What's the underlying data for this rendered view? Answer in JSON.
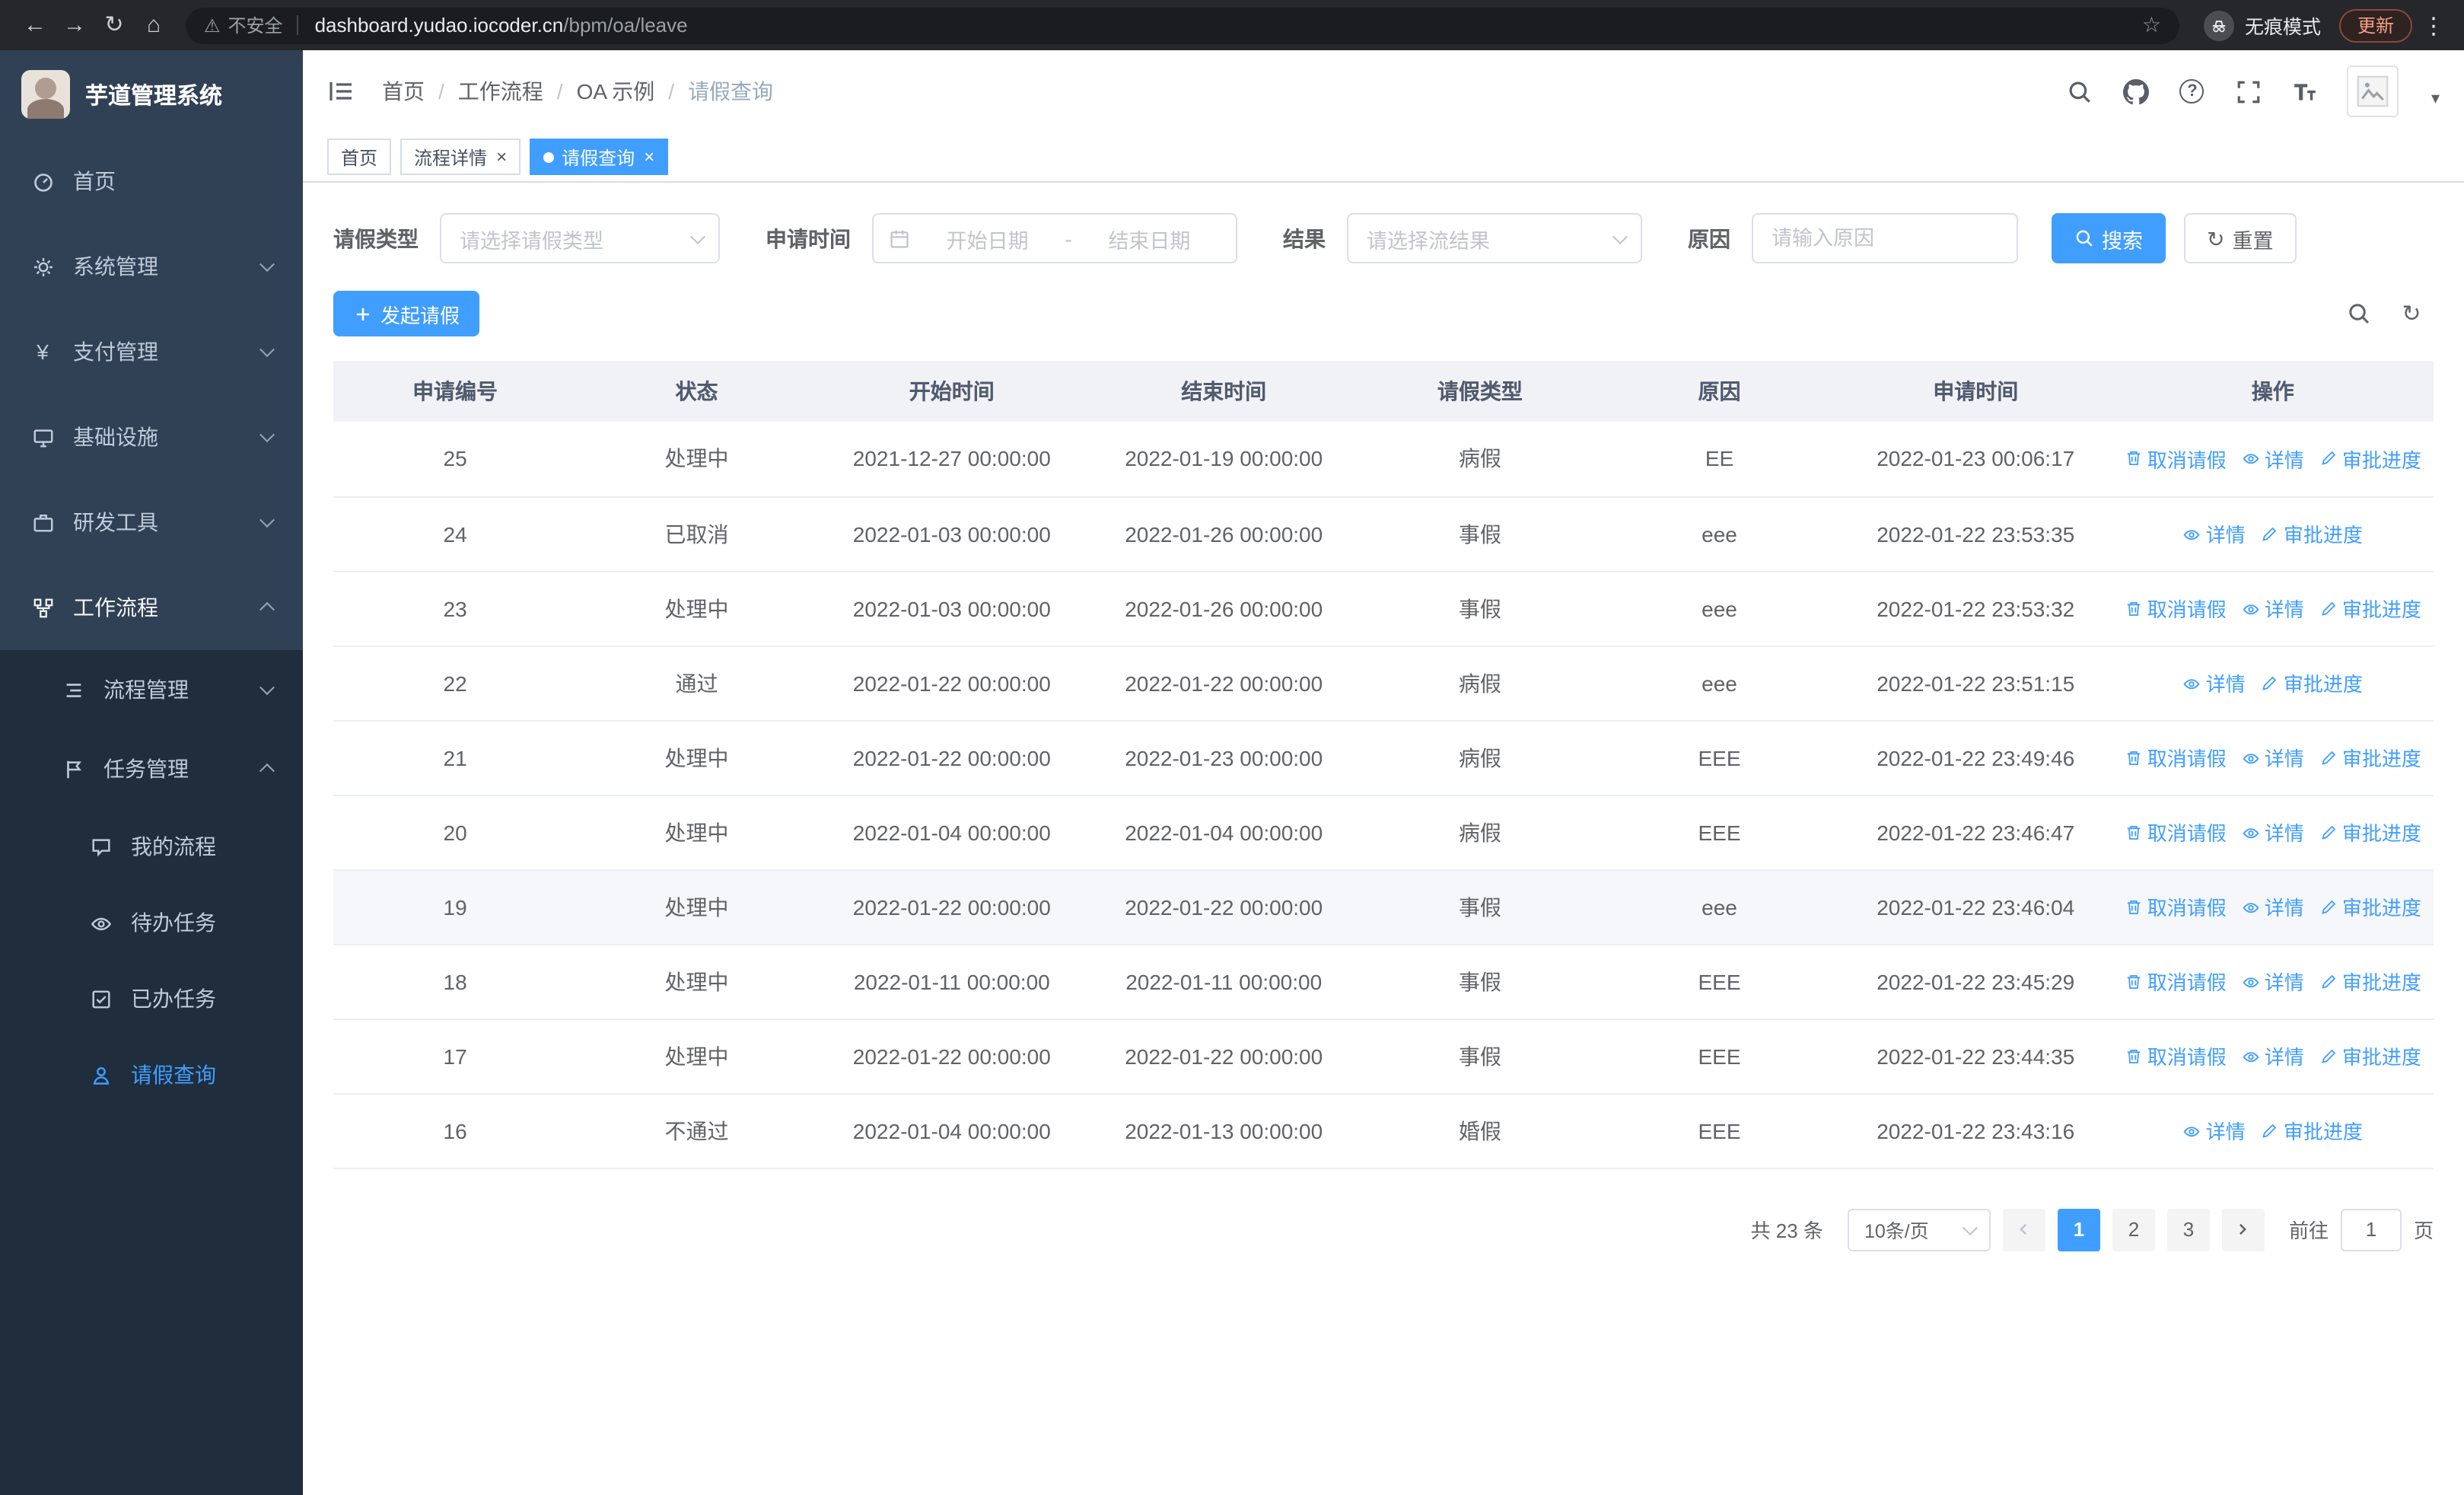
{
  "icons": {
    "back": "←",
    "forward": "→",
    "reload": "↻",
    "home": "⌂",
    "warning": "⚠",
    "star": "☆",
    "menu_dots": "⋮",
    "caret": "▾",
    "close": "×",
    "refresh": "↻",
    "question": "?",
    "yen": "¥"
  },
  "browser": {
    "security_label": "不安全",
    "url_domain": "dashboard.yudao.iocoder.cn",
    "url_path": "/bpm/oa/leave",
    "incognito_label": "无痕模式",
    "update_label": "更新"
  },
  "sidebar": {
    "logo_title": "芋道管理系统",
    "items": [
      {
        "label": "首页"
      },
      {
        "label": "系统管理"
      },
      {
        "label": "支付管理"
      },
      {
        "label": "基础设施"
      },
      {
        "label": "研发工具"
      },
      {
        "label": "工作流程"
      }
    ],
    "submenu": [
      {
        "label": "流程管理"
      },
      {
        "label": "任务管理"
      }
    ],
    "tasks_children": [
      {
        "label": "我的流程"
      },
      {
        "label": "待办任务"
      },
      {
        "label": "已办任务"
      },
      {
        "label": "请假查询"
      }
    ]
  },
  "header": {
    "breadcrumb": [
      "首页",
      "工作流程",
      "OA 示例",
      "请假查询"
    ],
    "breadcrumb_separator": "/"
  },
  "tabs": [
    {
      "label": "首页"
    },
    {
      "label": "流程详情"
    },
    {
      "label": "请假查询"
    }
  ],
  "filters": {
    "leave_type_label": "请假类型",
    "leave_type_placeholder": "请选择请假类型",
    "apply_time_label": "申请时间",
    "start_date_placeholder": "开始日期",
    "date_separator": "-",
    "end_date_placeholder": "结束日期",
    "result_label": "结果",
    "result_placeholder": "请选择流结果",
    "reason_label": "原因",
    "reason_placeholder": "请输入原因",
    "search_button": "搜索",
    "reset_button": "重置"
  },
  "toolbar": {
    "create_button": "发起请假"
  },
  "table": {
    "columns": [
      "申请编号",
      "状态",
      "开始时间",
      "结束时间",
      "请假类型",
      "原因",
      "申请时间",
      "操作"
    ],
    "ops_labels": {
      "cancel": "取消请假",
      "detail": "详情",
      "progress": "审批进度"
    },
    "rows": [
      {
        "id": "25",
        "status": "处理中",
        "start": "2021-12-27 00:00:00",
        "end": "2022-01-19 00:00:00",
        "type": "病假",
        "reason": "EE",
        "applied": "2022-01-23 00:06:17",
        "ops": [
          "cancel",
          "detail",
          "progress"
        ]
      },
      {
        "id": "24",
        "status": "已取消",
        "start": "2022-01-03 00:00:00",
        "end": "2022-01-26 00:00:00",
        "type": "事假",
        "reason": "eee",
        "applied": "2022-01-22 23:53:35",
        "ops": [
          "detail",
          "progress"
        ]
      },
      {
        "id": "23",
        "status": "处理中",
        "start": "2022-01-03 00:00:00",
        "end": "2022-01-26 00:00:00",
        "type": "事假",
        "reason": "eee",
        "applied": "2022-01-22 23:53:32",
        "ops": [
          "cancel",
          "detail",
          "progress"
        ]
      },
      {
        "id": "22",
        "status": "通过",
        "start": "2022-01-22 00:00:00",
        "end": "2022-01-22 00:00:00",
        "type": "病假",
        "reason": "eee",
        "applied": "2022-01-22 23:51:15",
        "ops": [
          "detail",
          "progress"
        ]
      },
      {
        "id": "21",
        "status": "处理中",
        "start": "2022-01-22 00:00:00",
        "end": "2022-01-23 00:00:00",
        "type": "病假",
        "reason": "EEE",
        "applied": "2022-01-22 23:49:46",
        "ops": [
          "cancel",
          "detail",
          "progress"
        ]
      },
      {
        "id": "20",
        "status": "处理中",
        "start": "2022-01-04 00:00:00",
        "end": "2022-01-04 00:00:00",
        "type": "病假",
        "reason": "EEE",
        "applied": "2022-01-22 23:46:47",
        "ops": [
          "cancel",
          "detail",
          "progress"
        ]
      },
      {
        "id": "19",
        "status": "处理中",
        "start": "2022-01-22 00:00:00",
        "end": "2022-01-22 00:00:00",
        "type": "事假",
        "reason": "eee",
        "applied": "2022-01-22 23:46:04",
        "ops": [
          "cancel",
          "detail",
          "progress"
        ],
        "hover": true
      },
      {
        "id": "18",
        "status": "处理中",
        "start": "2022-01-11 00:00:00",
        "end": "2022-01-11 00:00:00",
        "type": "事假",
        "reason": "EEE",
        "applied": "2022-01-22 23:45:29",
        "ops": [
          "cancel",
          "detail",
          "progress"
        ]
      },
      {
        "id": "17",
        "status": "处理中",
        "start": "2022-01-22 00:00:00",
        "end": "2022-01-22 00:00:00",
        "type": "事假",
        "reason": "EEE",
        "applied": "2022-01-22 23:44:35",
        "ops": [
          "cancel",
          "detail",
          "progress"
        ]
      },
      {
        "id": "16",
        "status": "不通过",
        "start": "2022-01-04 00:00:00",
        "end": "2022-01-13 00:00:00",
        "type": "婚假",
        "reason": "EEE",
        "applied": "2022-01-22 23:43:16",
        "ops": [
          "detail",
          "progress"
        ]
      }
    ]
  },
  "pagination": {
    "total_text": "共 23 条",
    "page_size": "10条/页",
    "pages": [
      "1",
      "2",
      "3"
    ],
    "active_page": "1",
    "goto_label": "前往",
    "goto_value": "1",
    "goto_suffix": "页"
  },
  "colors": {
    "primary": "#409eff",
    "sidebar_bg": "#304156",
    "submenu_bg": "#1f2d3d",
    "tag_active": "#409eff"
  }
}
